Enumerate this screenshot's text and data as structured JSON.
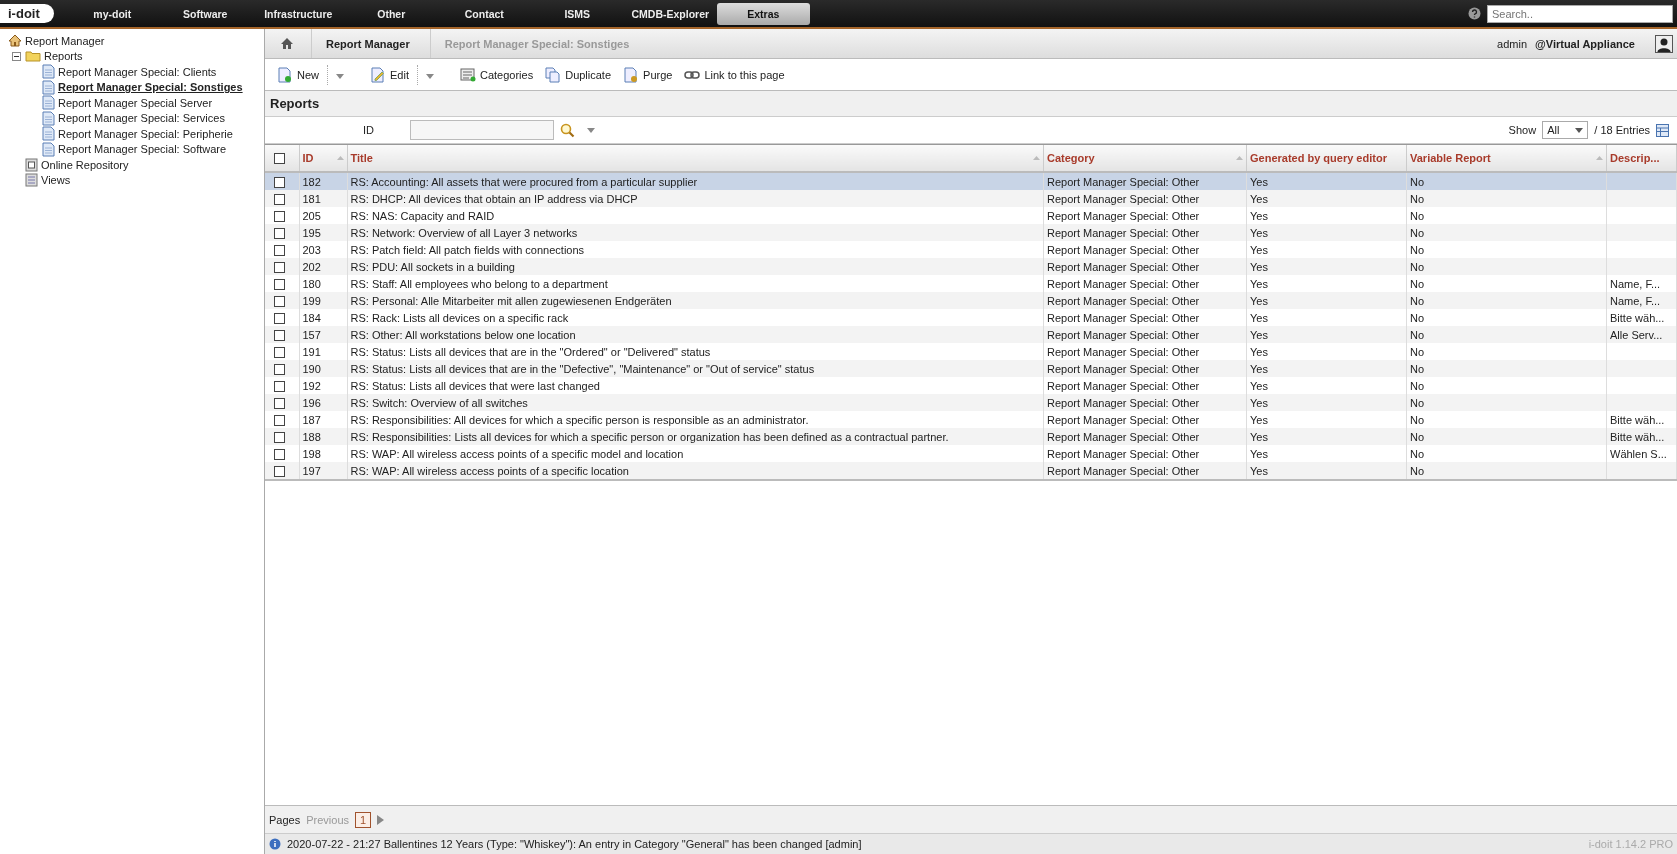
{
  "topnav": {
    "logo": "i-doit",
    "items": [
      {
        "label": "my-doit",
        "selected": false
      },
      {
        "label": "Software",
        "selected": false
      },
      {
        "label": "Infrastructure",
        "selected": false
      },
      {
        "label": "Other",
        "selected": false
      },
      {
        "label": "Contact",
        "selected": false
      },
      {
        "label": "ISMS",
        "selected": false
      },
      {
        "label": "CMDB-Explorer",
        "selected": false
      },
      {
        "label": "Extras",
        "selected": true
      }
    ],
    "search": {
      "placeholder": "Search.."
    }
  },
  "sidebar": {
    "tree": [
      {
        "label": "Report Manager",
        "children": [
          {
            "label": "Reports",
            "kind": "folder",
            "expanded": true,
            "children": [
              {
                "label": "Report Manager Special: Clients",
                "selected": false
              },
              {
                "label": "Report Manager Special: Sonstiges",
                "selected": true
              },
              {
                "label": "Report Manager Special Server",
                "selected": false
              },
              {
                "label": "Report Manager Special: Services",
                "selected": false
              },
              {
                "label": "Report Manager Special: Peripherie",
                "selected": false
              },
              {
                "label": "Report Manager Special: Software",
                "selected": false
              }
            ]
          },
          {
            "label": "Online Repository",
            "kind": "repository"
          },
          {
            "label": "Views",
            "kind": "views"
          }
        ]
      }
    ]
  },
  "breadcrumb": [
    "Report Manager",
    "Report Manager Special: Sonstiges"
  ],
  "user": {
    "name": "admin",
    "tenant": "@Virtual Appliance"
  },
  "toolbar": [
    {
      "label": "New",
      "kind": "new",
      "dropdown": true
    },
    {
      "label": "Edit",
      "kind": "edit",
      "dropdown": true
    },
    {
      "label": "Categories",
      "kind": "categories",
      "dropdown": false
    },
    {
      "label": "Duplicate",
      "kind": "duplicate",
      "dropdown": false
    },
    {
      "label": "Purge",
      "kind": "purge",
      "dropdown": false
    },
    {
      "label": "Link to this page",
      "kind": "link",
      "dropdown": false
    }
  ],
  "list": {
    "title": "Reports",
    "filter": {
      "label": "ID"
    },
    "show": {
      "label": "Show",
      "value": "All",
      "entries": "/ 18 Entries"
    },
    "columns": [
      {
        "label": "ID",
        "sortable": true
      },
      {
        "label": "Title",
        "sortable": true
      },
      {
        "label": "Category",
        "sortable": true
      },
      {
        "label": "Generated by query editor",
        "sortable": false
      },
      {
        "label": "Variable Report",
        "sortable": true
      },
      {
        "label": "Descrip...",
        "sortable": false
      }
    ],
    "header_checked": false,
    "rows": [
      {
        "selected": true,
        "checked": false,
        "cells": [
          "182",
          "RS: Accounting: All assets that were procured from a particular supplier",
          "Report Manager Special: Other",
          "Yes",
          "No",
          ""
        ]
      },
      {
        "selected": false,
        "checked": false,
        "cells": [
          "181",
          "RS: DHCP: All devices that obtain an IP address via DHCP",
          "Report Manager Special: Other",
          "Yes",
          "No",
          ""
        ]
      },
      {
        "selected": false,
        "checked": false,
        "cells": [
          "205",
          "RS: NAS: Capacity and RAID",
          "Report Manager Special: Other",
          "Yes",
          "No",
          ""
        ]
      },
      {
        "selected": false,
        "checked": false,
        "cells": [
          "195",
          "RS: Network: Overview of all Layer 3 networks",
          "Report Manager Special: Other",
          "Yes",
          "No",
          ""
        ]
      },
      {
        "selected": false,
        "checked": false,
        "cells": [
          "203",
          "RS: Patch field: All patch fields with connections",
          "Report Manager Special: Other",
          "Yes",
          "No",
          ""
        ]
      },
      {
        "selected": false,
        "checked": false,
        "cells": [
          "202",
          "RS: PDU: All sockets in a building",
          "Report Manager Special: Other",
          "Yes",
          "No",
          ""
        ]
      },
      {
        "selected": false,
        "checked": false,
        "cells": [
          "180",
          "RS: Staff: All employees who belong to a department",
          "Report Manager Special: Other",
          "Yes",
          "No",
          "Name, F..."
        ]
      },
      {
        "selected": false,
        "checked": false,
        "cells": [
          "199",
          "RS: Personal: Alle Mitarbeiter mit allen zugewiesenen Endgeräten",
          "Report Manager Special: Other",
          "Yes",
          "No",
          "Name, F..."
        ]
      },
      {
        "selected": false,
        "checked": false,
        "cells": [
          "184",
          "RS: Rack: Lists all devices on a specific rack",
          "Report Manager Special: Other",
          "Yes",
          "No",
          "Bitte wäh..."
        ]
      },
      {
        "selected": false,
        "checked": false,
        "cells": [
          "157",
          "RS: Other: All workstations below one location",
          "Report Manager Special: Other",
          "Yes",
          "No",
          "Alle Serv..."
        ]
      },
      {
        "selected": false,
        "checked": false,
        "cells": [
          "191",
          "RS: Status: Lists all devices that are in the \"Ordered\" or \"Delivered\" status",
          "Report Manager Special: Other",
          "Yes",
          "No",
          ""
        ]
      },
      {
        "selected": false,
        "checked": false,
        "cells": [
          "190",
          "RS: Status: Lists all devices that are in the \"Defective\", \"Maintenance\" or \"Out of service\" status",
          "Report Manager Special: Other",
          "Yes",
          "No",
          ""
        ]
      },
      {
        "selected": false,
        "checked": false,
        "cells": [
          "192",
          "RS: Status: Lists all devices that were last changed",
          "Report Manager Special: Other",
          "Yes",
          "No",
          ""
        ]
      },
      {
        "selected": false,
        "checked": false,
        "cells": [
          "196",
          "RS: Switch: Overview of all switches",
          "Report Manager Special: Other",
          "Yes",
          "No",
          ""
        ]
      },
      {
        "selected": false,
        "checked": false,
        "cells": [
          "187",
          "RS: Responsibilities: All devices for which a specific person is responsible as an administrator.",
          "Report Manager Special: Other",
          "Yes",
          "No",
          "Bitte wäh..."
        ]
      },
      {
        "selected": false,
        "checked": false,
        "cells": [
          "188",
          "RS: Responsibilities: Lists all devices for which a specific person or organization has been defined as a contractual partner.",
          "Report Manager Special: Other",
          "Yes",
          "No",
          "Bitte wäh..."
        ]
      },
      {
        "selected": false,
        "checked": false,
        "cells": [
          "198",
          "RS: WAP: All wireless access points of a specific model and location",
          "Report Manager Special: Other",
          "Yes",
          "No",
          "Wählen S..."
        ]
      },
      {
        "selected": false,
        "checked": false,
        "cells": [
          "197",
          "RS: WAP: All wireless access points of a specific location",
          "Report Manager Special: Other",
          "Yes",
          "No",
          ""
        ]
      }
    ]
  },
  "pager": {
    "label": "Pages",
    "previous": "Previous",
    "previous_disabled": true,
    "pages": [
      {
        "label": "1",
        "selected": true
      }
    ]
  },
  "status_bar": {
    "message": "2020-07-22 - 21:27 Ballentines 12 Years (Type: \"Whiskey\"): An entry in Category \"General\" has been changed [admin]",
    "version": "i-doit 1.14.2 PRO"
  }
}
